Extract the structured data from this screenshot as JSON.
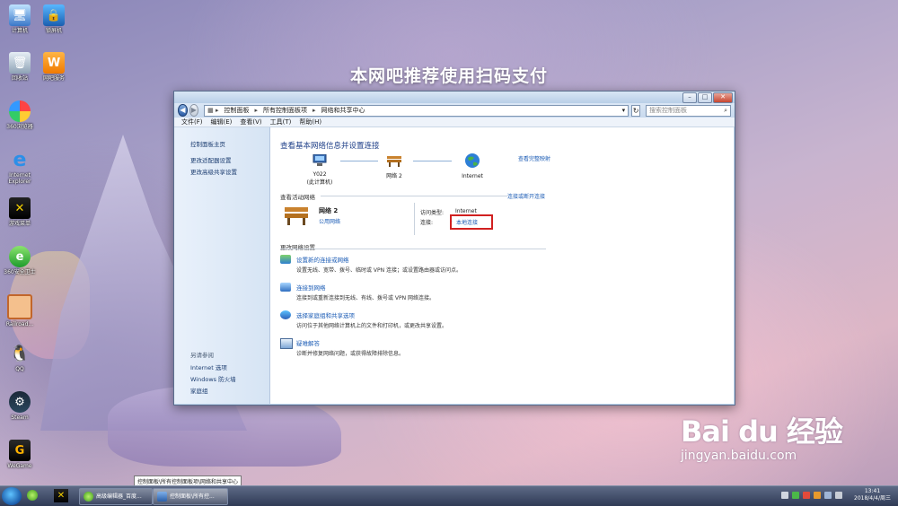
{
  "banner": {
    "text": "本网吧推荐使用扫码支付"
  },
  "desktop_icons": [
    {
      "label": "计算机"
    },
    {
      "label": "锁屏机"
    },
    {
      "label": "回收站"
    },
    {
      "label": "网吧服务"
    },
    {
      "label": "360浏览器"
    },
    {
      "label": "Internet Explorer"
    },
    {
      "label": "游戏菜单"
    },
    {
      "label": "360安全卫士"
    },
    {
      "label": "Railroad..."
    },
    {
      "label": "QQ"
    },
    {
      "label": "Steam"
    },
    {
      "label": "WeGame"
    }
  ],
  "window": {
    "address": {
      "segments": [
        "控制面板",
        "所有控制面板项",
        "网络和共享中心"
      ]
    },
    "search_placeholder": "搜索控制面板",
    "menu": [
      "文件(F)",
      "编辑(E)",
      "查看(V)",
      "工具(T)",
      "帮助(H)"
    ],
    "sidebar": {
      "links": [
        "控制面板主页",
        "更改适配器设置",
        "更改高级共享设置"
      ],
      "see_also_title": "另请参阅",
      "see_also": [
        "Internet 选项",
        "Windows 防火墙",
        "家庭组"
      ]
    },
    "content": {
      "title": "查看基本网络信息并设置连接",
      "full_map": "查看完整映射",
      "nodes": [
        {
          "label": "Y022",
          "sub": "(此计算机)"
        },
        {
          "label": "网络  2",
          "sub": ""
        },
        {
          "label": "Internet",
          "sub": ""
        }
      ],
      "active_networks_title": "查看活动网络",
      "connect_disconnect": "连接或断开连接",
      "network": {
        "name": "网络  2",
        "type": "公用网络",
        "access_label": "访问类型:",
        "access_value": "Internet",
        "conn_label": "连接:",
        "conn_value": "本地连接"
      },
      "change_settings_title": "更改网络设置",
      "tasks": [
        {
          "title": "设置新的连接或网络",
          "desc": "设置无线、宽带、拨号、临时或 VPN 连接；或设置路由器或访问点。"
        },
        {
          "title": "连接到网络",
          "desc": "连接到或重新连接到无线、有线、拨号或 VPN 网络连接。"
        },
        {
          "title": "选择家庭组和共享选项",
          "desc": "访问位于其他网络计算机上的文件和打印机，或更改共享设置。"
        },
        {
          "title": "疑难解答",
          "desc": "诊断并修复网络问题，或获得故障排除信息。"
        }
      ]
    }
  },
  "taskbar": {
    "tooltip": "控制面板\\所有控制面板项\\网络和共享中心",
    "buttons": [
      "高级编辑器_百度...",
      "控制面板\\所有控..."
    ],
    "time": "13:41",
    "date": "2018/4/4/周三"
  },
  "watermark": {
    "logo": "Bai du 经验",
    "url": "jingyan.baidu.com"
  }
}
